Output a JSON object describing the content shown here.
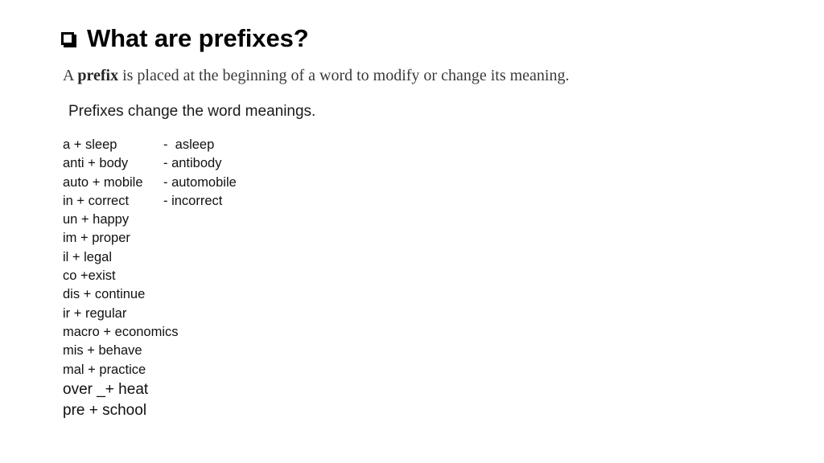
{
  "slide": {
    "background_color": "#ffffff",
    "title": {
      "bullet_icon": "white-square-shadowed",
      "text": "What are prefixes?"
    },
    "definition": {
      "lead": "A ",
      "emphasis": "prefix",
      "rest": " is placed at the beginning of a word to modify or change its meaning."
    },
    "intro": "Prefixes change the word meanings.",
    "examples": [
      {
        "left": "a + sleep",
        "right": "-  asleep"
      },
      {
        "left": "anti + body",
        "right": "- antibody"
      },
      {
        "left": "auto + mobile",
        "right": "- automobile"
      },
      {
        "left": "in + correct",
        "right": "- incorrect"
      },
      {
        "left": "un + happy",
        "right": ""
      },
      {
        "left": "im + proper",
        "right": ""
      },
      {
        "left": "il + legal",
        "right": ""
      },
      {
        "left": "co +exist",
        "right": ""
      },
      {
        "left": "dis + continue",
        "right": ""
      },
      {
        "left": "ir + regular",
        "right": ""
      },
      {
        "left": "macro + economics",
        "right": ""
      },
      {
        "left": "mis + behave",
        "right": ""
      },
      {
        "left": "mal + practice",
        "right": ""
      },
      {
        "left": "over _+ heat",
        "right": ""
      },
      {
        "left": "pre + school",
        "right": ""
      }
    ],
    "colors": {
      "title_text": "#000000",
      "definition_text": "#3a3a3a",
      "body_text": "#111111"
    }
  }
}
